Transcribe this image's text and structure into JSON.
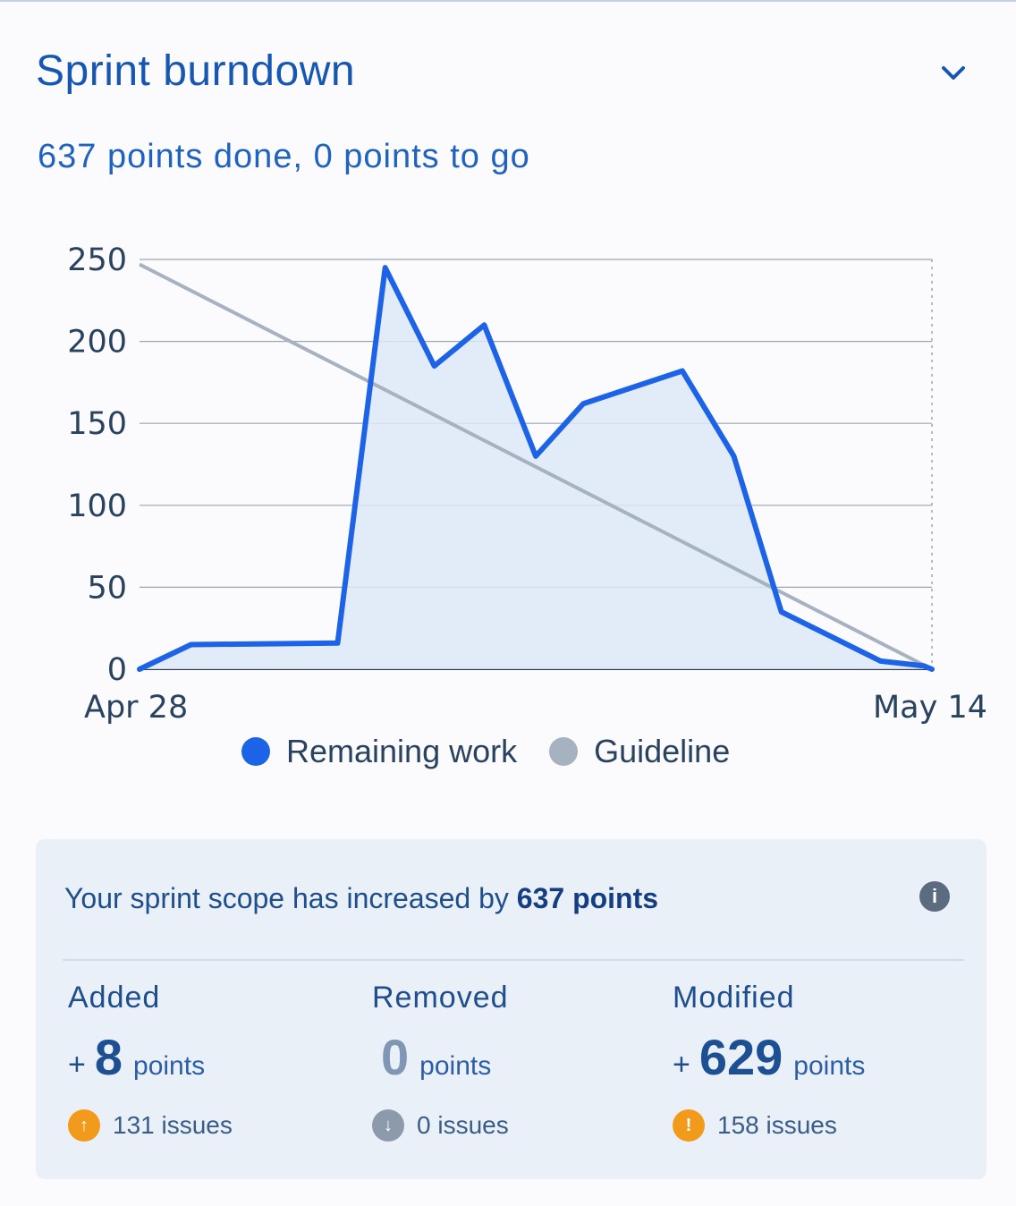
{
  "header": {
    "title": "Sprint burndown",
    "collapse_icon": "chevron-down-icon",
    "summary": "637 points done, 0 points to go"
  },
  "chart_data": {
    "type": "line",
    "x_labels": [
      "Apr 28",
      "May 14"
    ],
    "ylim": [
      0,
      250
    ],
    "yticks": [
      0,
      50,
      100,
      150,
      200,
      250
    ],
    "grid": true,
    "legend_position": "bottom",
    "series": [
      {
        "name": "Remaining work",
        "color": "#1d63e8",
        "fill": true,
        "x": [
          0,
          0.065,
          0.25,
          0.31,
          0.372,
          0.435,
          0.5,
          0.56,
          0.685,
          0.75,
          0.81,
          0.935,
          0.99,
          1.0
        ],
        "y": [
          0,
          15,
          16,
          245,
          185,
          210,
          130,
          162,
          182,
          130,
          35,
          5,
          2,
          0
        ]
      },
      {
        "name": "Guideline",
        "color": "#a7b2c0",
        "x": [
          0,
          1
        ],
        "y": [
          247,
          0
        ]
      }
    ]
  },
  "legend": {
    "remaining_label": "Remaining work",
    "guideline_label": "Guideline",
    "remaining_color": "#1d63e8",
    "guideline_color": "#a7b2c0"
  },
  "scope": {
    "title_prefix": "Your sprint scope has increased by ",
    "title_highlight": "637 points",
    "info_icon": "info-icon",
    "added": {
      "label": "Added",
      "sign": "+",
      "value": "8",
      "unit": "points",
      "issues": "131 issues",
      "icon_color": "#f29a1b"
    },
    "removed": {
      "label": "Removed",
      "sign": "",
      "value": "0",
      "unit": "points",
      "issues": "0 issues",
      "icon_color": "#8d9aab"
    },
    "modified": {
      "label": "Modified",
      "sign": "+",
      "value": "629",
      "unit": "points",
      "issues": "158 issues",
      "icon_color": "#f29a1b"
    }
  }
}
